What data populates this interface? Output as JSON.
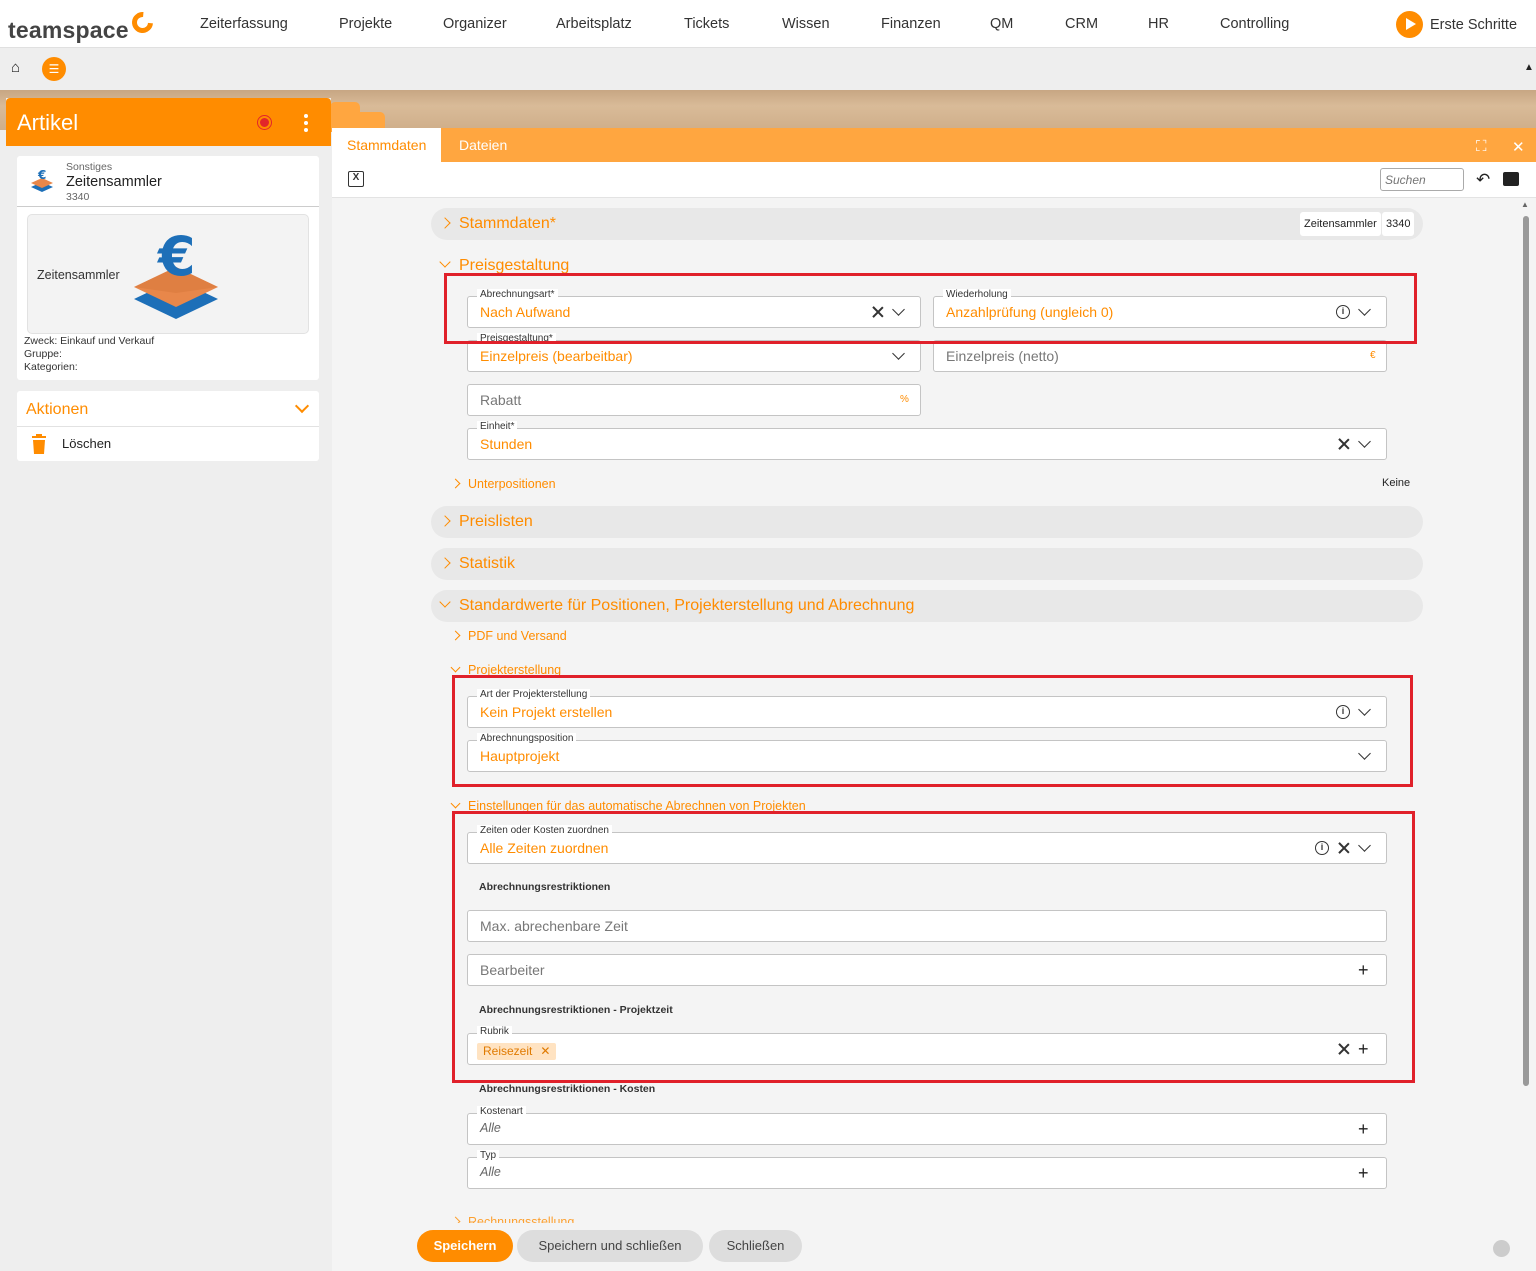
{
  "topnav": {
    "logo": "teamspace",
    "items": [
      "Zeiterfassung",
      "Projekte",
      "Organizer",
      "Arbeitsplatz",
      "Tickets",
      "Wissen",
      "Finanzen",
      "QM",
      "CRM",
      "HR",
      "Controlling"
    ],
    "erste_schritte": "Erste Schritte"
  },
  "leftpanel": {
    "title": "Artikel",
    "card": {
      "category": "Sonstiges",
      "name": "Zeitensammler",
      "number": "3340",
      "image_label": "Zeitensammler",
      "zweck": "Zweck: Einkauf und Verkauf",
      "gruppe": "Gruppe:",
      "kategorien": "Kategorien:"
    },
    "actions": {
      "title": "Aktionen",
      "delete": "Löschen"
    }
  },
  "main": {
    "tabs": [
      "Stammdaten",
      "Dateien"
    ],
    "search_placeholder": "Suchen",
    "sections": {
      "stammdaten": {
        "title": "Stammdaten*",
        "badge_name": "Zeitensammler",
        "badge_number": "3340"
      },
      "preisgestaltung": {
        "title": "Preisgestaltung"
      },
      "preislisten": {
        "title": "Preislisten"
      },
      "statistik": {
        "title": "Statistik"
      },
      "standardwerte": {
        "title": "Standardwerte für Positionen, Projekterstellung und Abrechnung"
      }
    },
    "fields": {
      "abrechnungsart": {
        "label": "Abrechnungsart*",
        "value": "Nach Aufwand"
      },
      "wiederholung": {
        "label": "Wiederholung",
        "value": "Anzahlprüfung (ungleich 0)"
      },
      "preisgestaltung": {
        "label": "Preisgestaltung*",
        "value": "Einzelpreis (bearbeitbar)"
      },
      "einzelpreis": {
        "placeholder": "Einzelpreis (netto)",
        "unit": "€"
      },
      "rabatt": {
        "placeholder": "Rabatt",
        "unit": "%"
      },
      "einheit": {
        "label": "Einheit*",
        "value": "Stunden"
      },
      "art_projekterstellung": {
        "label": "Art der Projekterstellung",
        "value": "Kein Projekt erstellen"
      },
      "abrechnungsposition": {
        "label": "Abrechnungsposition",
        "value": "Hauptprojekt"
      },
      "zeiten_kosten": {
        "label": "Zeiten oder Kosten zuordnen",
        "value": "Alle Zeiten zuordnen"
      },
      "max_zeit": {
        "placeholder": "Max. abrechenbare Zeit"
      },
      "bearbeiter": {
        "placeholder": "Bearbeiter"
      },
      "rubrik": {
        "label": "Rubrik",
        "chip": "Reisezeit"
      },
      "kostenart": {
        "label": "Kostenart",
        "value": "Alle"
      },
      "typ": {
        "label": "Typ",
        "value": "Alle"
      }
    },
    "subsections": {
      "unterpositionen": "Unterpositionen",
      "unterpositionen_badge": "Keine",
      "pdf": "PDF und Versand",
      "projekterstellung": "Projekterstellung",
      "einstellungen": "Einstellungen für das automatische Abrechnen von Projekten",
      "cut": "Rechnungsstellung"
    },
    "groups": {
      "abrechnungsrestriktionen": "Abrechnungsrestriktionen",
      "projektzeit": "Abrechnungsrestriktionen - Projektzeit",
      "kosten": "Abrechnungsrestriktionen - Kosten"
    },
    "buttons": {
      "save": "Speichern",
      "save_close": "Speichern und schließen",
      "close": "Schließen"
    }
  },
  "colors": {
    "accent": "#ff8c00",
    "tab_bar": "#ffa640",
    "highlight": "#e0202a"
  }
}
